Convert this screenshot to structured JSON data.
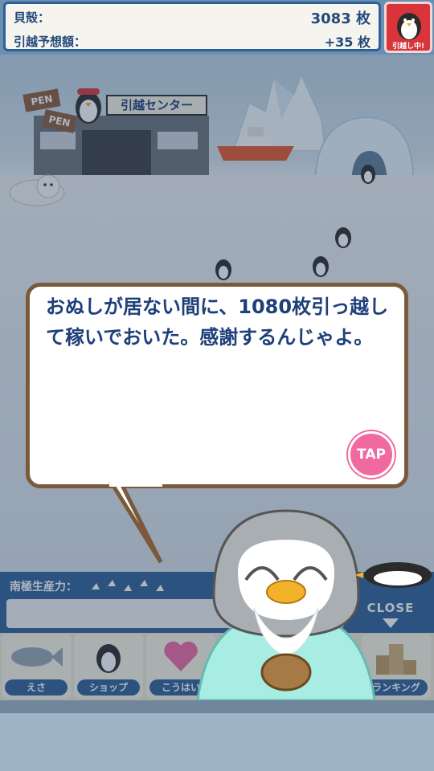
{
  "header": {
    "shells_label": "貝殻：",
    "shells_value": "3083 枚",
    "moving_estimate_label": "引越予想額：",
    "moving_estimate_value": "+35 枚",
    "moving_status": "引越し中!"
  },
  "scene": {
    "shop_sign": "引越センター",
    "box_label_1": "PEN",
    "box_label_2": "PEN"
  },
  "dialog": {
    "message": "おぬしが居ない間に、1080枚引っ越して稼いでおいた。感謝するんじゃよ。",
    "tap_label": "TAP"
  },
  "production": {
    "label": "南極生産力："
  },
  "close_label": "CLOSE",
  "tabs": [
    {
      "label": "えさ"
    },
    {
      "label": "ショップ"
    },
    {
      "label": "こうはい"
    },
    {
      "label": "ランキング"
    }
  ],
  "colors": {
    "accent": "#2f5f97",
    "bubble_text": "#1d3f7a",
    "tap": "#f06aa0",
    "moving_button": "#d9343a"
  }
}
